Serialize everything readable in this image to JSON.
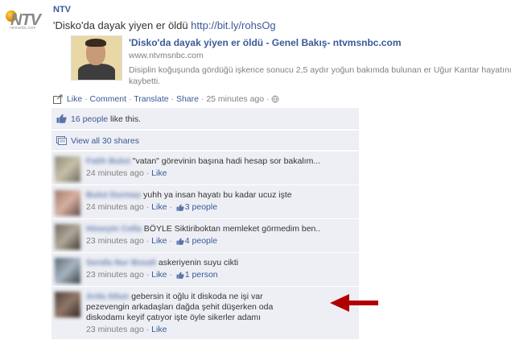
{
  "post": {
    "author": "NTV",
    "logo_text": "NTV",
    "logo_sub": "ntvmsnbc.com",
    "message_text": "'Disko'da dayak yiyen er öldü ",
    "message_url": "http://bit.ly/rohsOg",
    "attachment": {
      "title": "'Disko'da dayak yiyen er öldü - Genel Bakış- ntvmsnbc.com",
      "domain": "www.ntvmsnbc.com",
      "description": "Disiplin koğuşunda gördüğü işkence sonucu 2,5 aydır yoğun bakımda bulunan er Uğur Kantar hayatını kaybetti."
    },
    "actions": {
      "like": "Like",
      "comment": "Comment",
      "translate": "Translate",
      "share": "Share",
      "sep": " · ",
      "time": "25 minutes ago",
      "dot": " · "
    }
  },
  "ufi": {
    "likes_count": "16 people",
    "likes_suffix": " like this.",
    "view_all": "View all 30 shares"
  },
  "comments": [
    {
      "name": "Fatih Bulut",
      "text": "\"vatan\" görevinin başına hadi hesap sor bakalım...",
      "time": "24 minutes ago",
      "like": "Like",
      "likes": ""
    },
    {
      "name": "Bulut Durmaz",
      "text": "yuhh ya insan hayatı bu kadar ucuz işte",
      "time": "24 minutes ago",
      "like": "Like",
      "likes": "3 people"
    },
    {
      "name": "Hüseyin Cella",
      "text": "BÖYLE Siktiriboktan memleket görmedim ben..",
      "time": "23 minutes ago",
      "like": "Like",
      "likes": "4 people"
    },
    {
      "name": "Serafa Nur Bozali",
      "text": "askeriyenin suyu cikti",
      "time": "23 minutes ago",
      "like": "Like",
      "likes": "1 person"
    },
    {
      "name": "Arda Altun",
      "text": "gebersin it oğlu it diskoda ne işi var pezevengin arkadaşları dağda şehit düşerken oda diskodamı keyif çatıyor işte öyle sikerler adamı",
      "time": "23 minutes ago",
      "like": "Like",
      "likes": ""
    }
  ],
  "colors": {
    "link": "#3b5998",
    "ufi_bg": "#edeff4",
    "muted": "#808080",
    "arrow": "#b00000"
  },
  "icons": {
    "like_action": "share-box-icon",
    "time": "globe-icon",
    "likes": "thumbs-up-icon",
    "shares": "shares-icon",
    "annotation": "red-arrow-icon"
  }
}
